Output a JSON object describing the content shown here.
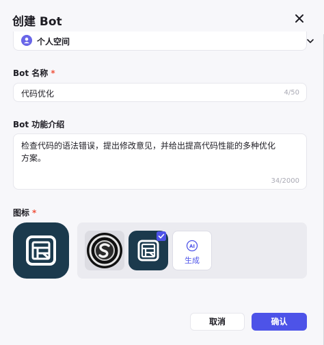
{
  "dialog": {
    "title": "创建 Bot",
    "workspace": {
      "selected": "个人空间"
    },
    "name_field": {
      "label": "Bot 名称",
      "required_mark": "*",
      "value": "代码优化",
      "counter": "4/50"
    },
    "description_field": {
      "label": "Bot 功能介绍",
      "value": "检查代码的语法错误，提出修改意见，并给出提高代码性能的多种优化方案。",
      "counter": "34/2000"
    },
    "icon_field": {
      "label": "图标",
      "required_mark": "*",
      "options": [
        {
          "icon": "s-coin-icon",
          "selected": false
        },
        {
          "icon": "code-window-icon",
          "selected": true
        }
      ],
      "generate_label": "生成",
      "generate_icon": "ai-icon"
    },
    "buttons": {
      "cancel": "取消",
      "confirm": "确认"
    }
  },
  "colors": {
    "accent": "#4d53e8",
    "icon_bg": "#1b3a4d",
    "required": "#f0533d"
  }
}
